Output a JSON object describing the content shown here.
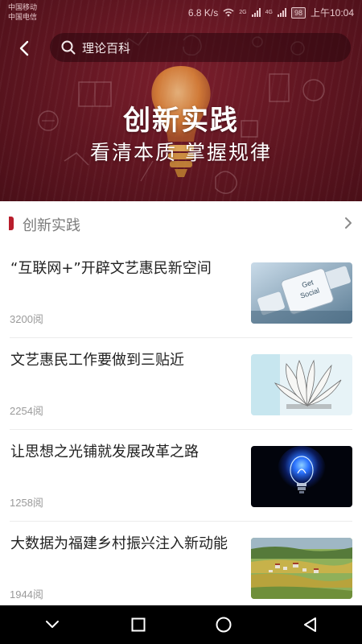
{
  "status_bar": {
    "carrier_1": "中国移动",
    "carrier_2": "中国电信",
    "speed": "6.8 K/s",
    "network_1": "2G",
    "network_2": "4G",
    "battery": "98",
    "time": "上午10:04"
  },
  "header": {
    "search_text": "理论百科",
    "hero_title": "创新实践",
    "hero_subtitle": "看清本质 掌握规律"
  },
  "section": {
    "title": "创新实践"
  },
  "articles": [
    {
      "title": "“互联网+”开辟文艺惠民新空间",
      "reads": "3200阅",
      "thumb": "keyboard-social-key"
    },
    {
      "title": "文艺惠民工作要做到三贴近",
      "reads": "2254阅",
      "thumb": "open-book-pages"
    },
    {
      "title": "让思想之光铺就发展改革之路",
      "reads": "1258阅",
      "thumb": "glowing-blue-bulb"
    },
    {
      "title": "大数据为福建乡村振兴注入新动能",
      "reads": "1944阅",
      "thumb": "village-terraced-fields"
    }
  ],
  "thumb_texts": {
    "keyboard_line1": "Get",
    "keyboard_line2": "Social"
  },
  "colors": {
    "hero_bg": "#5e1520",
    "accent": "#b81d2c",
    "nav_bg": "#000000"
  }
}
